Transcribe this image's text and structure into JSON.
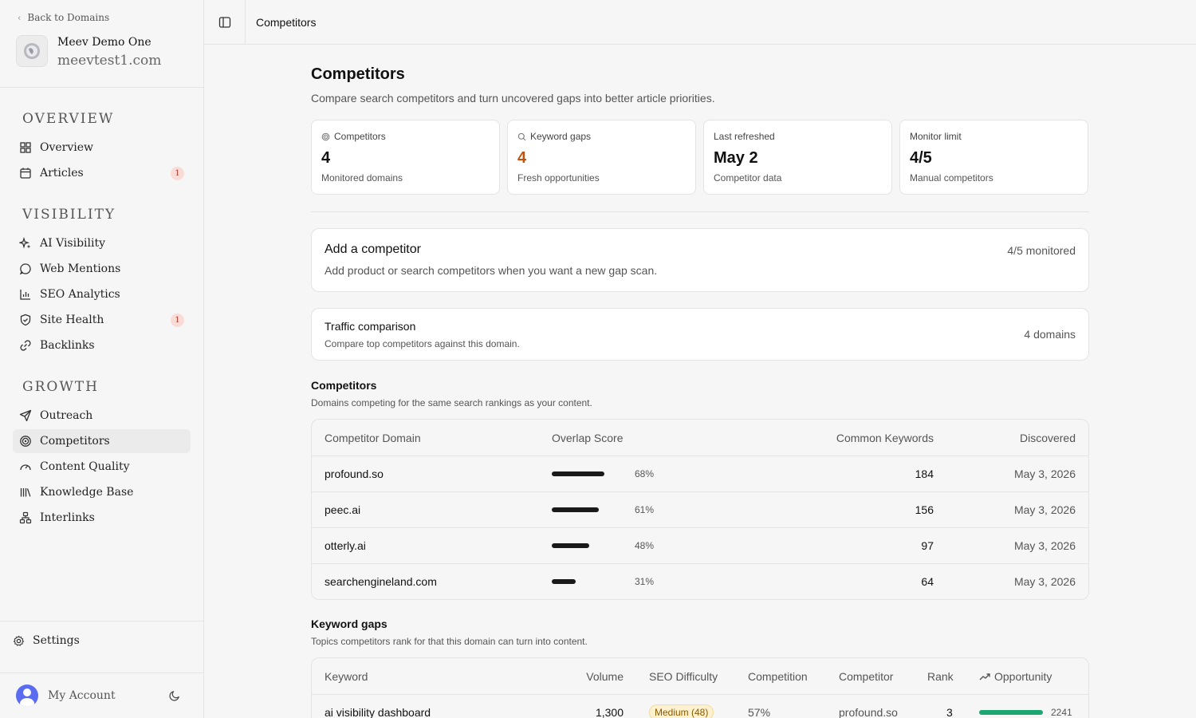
{
  "sidebar": {
    "back_label": "Back to Domains",
    "domain_name": "Meev Demo One",
    "domain_url": "meevtest1.com",
    "sections": [
      {
        "label": "OVERVIEW"
      },
      {
        "label": "VISIBILITY"
      },
      {
        "label": "GROWTH"
      }
    ],
    "items": {
      "overview": "Overview",
      "articles": "Articles",
      "articles_badge": "1",
      "ai_visibility": "AI Visibility",
      "web_mentions": "Web Mentions",
      "seo_analytics": "SEO Analytics",
      "site_health": "Site Health",
      "site_health_badge": "1",
      "backlinks": "Backlinks",
      "outreach": "Outreach",
      "competitors": "Competitors",
      "content_quality": "Content Quality",
      "knowledge_base": "Knowledge Base",
      "interlinks": "Interlinks"
    },
    "settings": "Settings",
    "account": "My Account"
  },
  "topbar": {
    "breadcrumb": "Competitors"
  },
  "page": {
    "title": "Competitors",
    "subtitle": "Compare search competitors and turn uncovered gaps into better article priorities."
  },
  "stats": [
    {
      "label": "Competitors",
      "value": "4",
      "caption": "Monitored domains",
      "icon": "target-icon"
    },
    {
      "label": "Keyword gaps",
      "value": "4",
      "caption": "Fresh opportunities",
      "icon": "search-icon"
    },
    {
      "label": "Last refreshed",
      "value": "May 2",
      "caption": "Competitor data"
    },
    {
      "label": "Monitor limit",
      "value": "4/5",
      "caption": "Manual competitors"
    }
  ],
  "add_competitor": {
    "title": "Add a competitor",
    "subtitle": "Add product or search competitors when you want a new gap scan.",
    "status": "4/5 monitored"
  },
  "traffic": {
    "title": "Traffic comparison",
    "subtitle": "Compare top competitors against this domain.",
    "status": "4 domains"
  },
  "competitors_section": {
    "title": "Competitors",
    "subtitle": "Domains competing for the same search rankings as your content.",
    "columns": [
      "Competitor Domain",
      "Overlap Score",
      "Common Keywords",
      "Discovered"
    ],
    "rows": [
      {
        "domain": "profound.so",
        "overlap": 68,
        "overlap_label": "68%",
        "common": "184",
        "discovered": "May 3, 2026"
      },
      {
        "domain": "peec.ai",
        "overlap": 61,
        "overlap_label": "61%",
        "common": "156",
        "discovered": "May 3, 2026"
      },
      {
        "domain": "otterly.ai",
        "overlap": 48,
        "overlap_label": "48%",
        "common": "97",
        "discovered": "May 3, 2026"
      },
      {
        "domain": "searchengineland.com",
        "overlap": 31,
        "overlap_label": "31%",
        "common": "64",
        "discovered": "May 3, 2026"
      }
    ]
  },
  "keyword_gaps": {
    "title": "Keyword gaps",
    "subtitle": "Topics competitors rank for that this domain can turn into content.",
    "columns": [
      "Keyword",
      "Volume",
      "SEO Difficulty",
      "Competition",
      "Competitor",
      "Rank",
      "Opportunity"
    ],
    "rows": [
      {
        "keyword": "ai visibility dashboard",
        "volume": "1,300",
        "difficulty": "Medium (48)",
        "competition": "57%",
        "competitor": "profound.so",
        "rank": "3",
        "opportunity": "2241"
      }
    ]
  },
  "colors": {
    "accent_orange": "#c2530a",
    "opportunity_green": "#1ea672",
    "badge_red": "#c0392b"
  }
}
